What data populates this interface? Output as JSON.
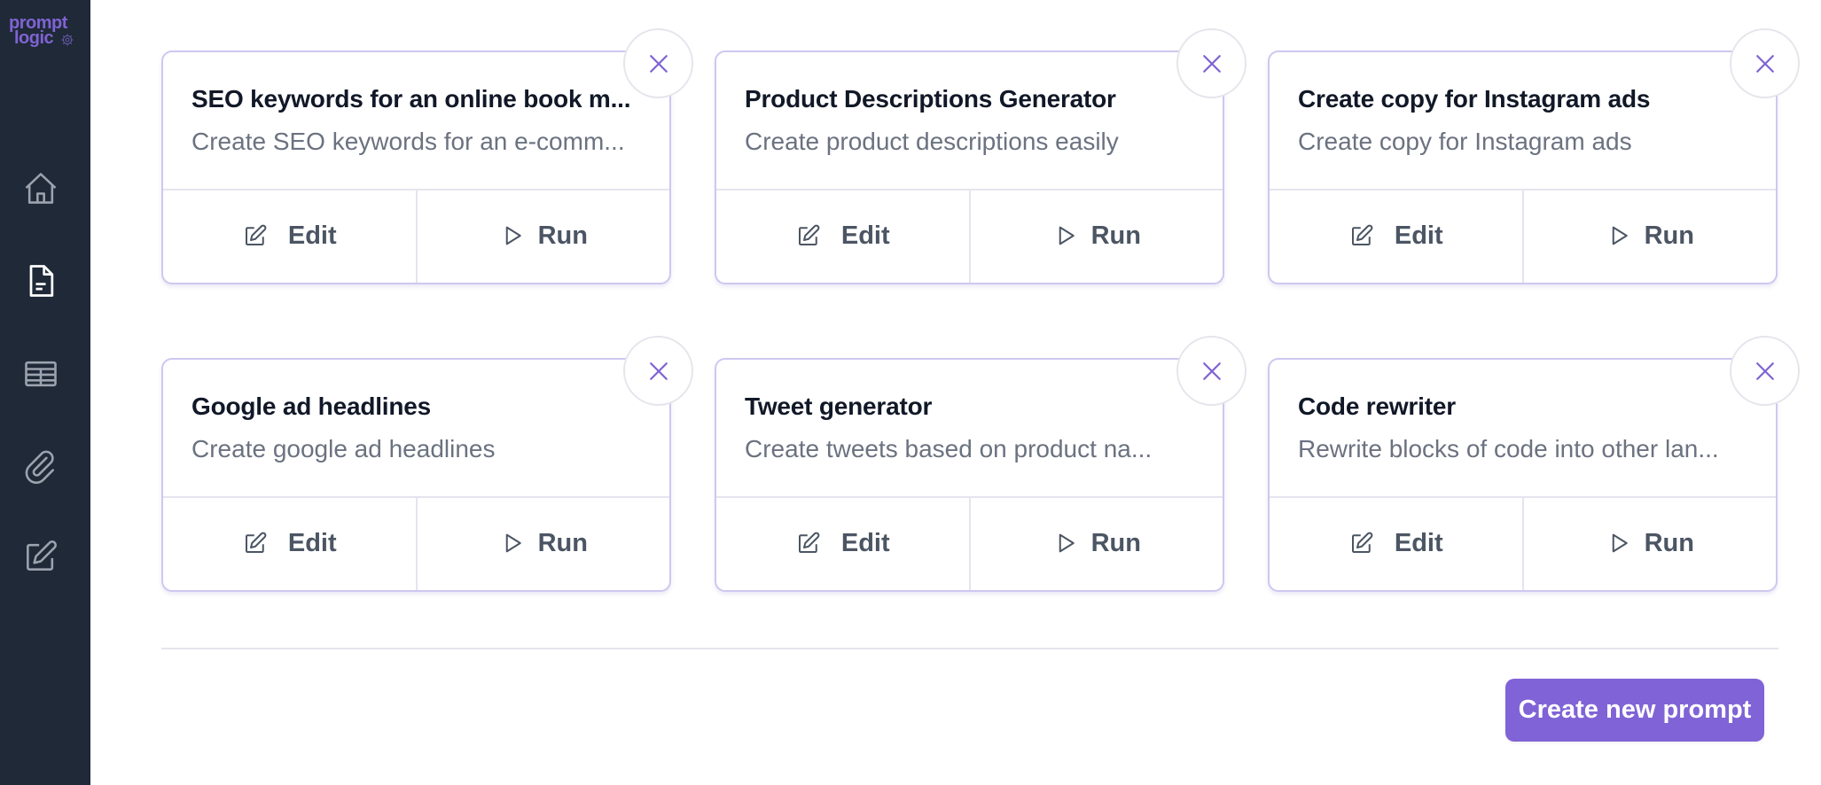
{
  "app": {
    "logo_line1": "prompt",
    "logo_line2": "logic",
    "brand_color": "#7f63d3"
  },
  "sidebar": {
    "items": [
      {
        "name": "home",
        "icon": "home-icon",
        "active": false
      },
      {
        "name": "prompts",
        "icon": "document-icon",
        "active": true
      },
      {
        "name": "tables",
        "icon": "table-icon",
        "active": false
      },
      {
        "name": "attachments",
        "icon": "paperclip-icon",
        "active": false
      },
      {
        "name": "editor",
        "icon": "edit-icon",
        "active": false
      }
    ]
  },
  "prompts": [
    {
      "title": "SEO keywords for an online book m...",
      "description": "Create SEO keywords for an e-comm...",
      "edit_label": "Edit",
      "run_label": "Run"
    },
    {
      "title": "Product Descriptions Generator",
      "description": "Create product descriptions easily",
      "edit_label": "Edit",
      "run_label": "Run"
    },
    {
      "title": "Create copy for Instagram ads",
      "description": "Create copy for Instagram ads",
      "edit_label": "Edit",
      "run_label": "Run"
    },
    {
      "title": "Google ad headlines",
      "description": "Create google ad headlines",
      "edit_label": "Edit",
      "run_label": "Run"
    },
    {
      "title": "Tweet generator",
      "description": "Create tweets based on product na...",
      "edit_label": "Edit",
      "run_label": "Run"
    },
    {
      "title": "Code rewriter",
      "description": "Rewrite blocks of code into other lan...",
      "edit_label": "Edit",
      "run_label": "Run"
    }
  ],
  "footer": {
    "create_label": "Create new prompt",
    "accent_color": "#8063d6"
  }
}
